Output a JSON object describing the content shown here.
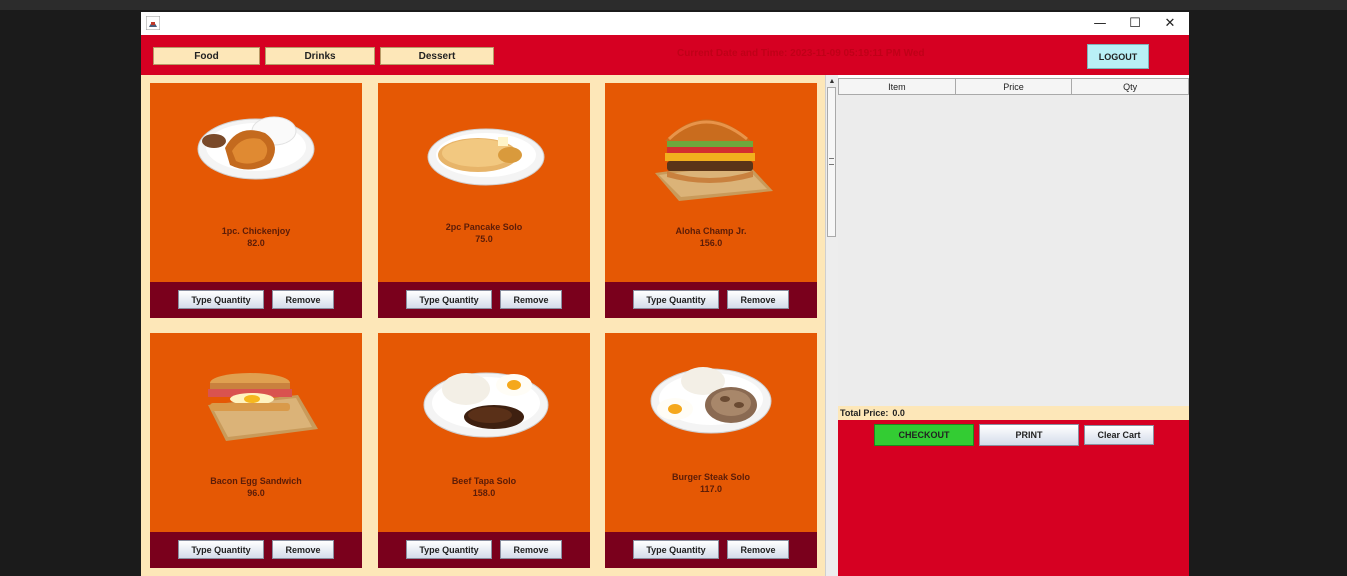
{
  "window": {
    "icon": "java-app-icon",
    "controls": {
      "minimize": "—",
      "maximize": "☐",
      "close": "✕"
    }
  },
  "header": {
    "categories": [
      "Food",
      "Drinks",
      "Dessert"
    ],
    "datetime": "Current Date and Time: 2023-11-09 05:19:11 PM Wed",
    "logout_label": "LOGOUT"
  },
  "menu_items": [
    {
      "name": "1pc. Chickenjoy",
      "price": "82.0",
      "image": "chicken-plate"
    },
    {
      "name": "2pc Pancake Solo",
      "price": "75.0",
      "image": "pancake-plate"
    },
    {
      "name": "Aloha Champ Jr.",
      "price": "156.0",
      "image": "burger"
    },
    {
      "name": "Bacon Egg Sandwich",
      "price": "96.0",
      "image": "sandwich"
    },
    {
      "name": "Beef Tapa Solo",
      "price": "158.0",
      "image": "tapa-plate"
    },
    {
      "name": "Burger Steak Solo",
      "price": "117.0",
      "image": "burger-steak-plate"
    }
  ],
  "item_buttons": {
    "quantity_label": "Type Quantity",
    "remove_label": "Remove"
  },
  "cart": {
    "columns": [
      "Item",
      "Price",
      "Qty"
    ],
    "total_label": "Total Price:",
    "total_value": "0.0",
    "checkout_label": "CHECKOUT",
    "print_label": "PRINT",
    "clear_label": "Clear Cart"
  },
  "colors": {
    "brand_red": "#d60022",
    "card_orange": "#e55804",
    "card_footer": "#7a001c",
    "cream": "#fde7b8",
    "checkout_green": "#33cc33",
    "logout_cyan": "#b9f0f6"
  }
}
